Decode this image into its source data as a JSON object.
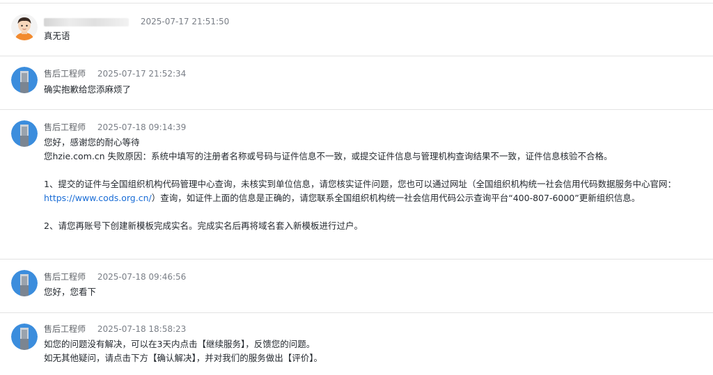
{
  "thread": {
    "messages": [
      {
        "author": "",
        "author_masked": true,
        "avatar": "user-avatar-cartoon-icon",
        "time": "2025-07-17 21:51:50",
        "lines": [
          "真无语"
        ]
      },
      {
        "author": "售后工程师",
        "avatar": "engineer-avatar-icon",
        "time": "2025-07-17 21:52:34",
        "lines": [
          "确实抱歉给您添麻烦了"
        ]
      },
      {
        "author": "售后工程师",
        "avatar": "engineer-avatar-icon",
        "time": "2025-07-18 09:14:39",
        "greeting": "您好，感谢您的耐心等待",
        "reason": "您hzie.com.cn 失败原因：系统中填写的注册者名称或号码与证件信息不一致，或提交证件信息与管理机构查询结果不一致，证件信息核验不合格。",
        "item1_prefix": "1、提交的证件与全国组织机构代码管理中心查询，未核实到单位信息，请您核实证件问题，您也可以通过网址（全国组织机构统一社会信用代码数据服务中心官网：",
        "item1_link": "https://www.cods.org.cn/",
        "item1_suffix": "）查询，如证件上面的信息是正确的，请您联系全国组织机构统一社会信用代码公示查询平台“400-807-6000”更新组织信息。",
        "item2": "2、请您再账号下创建新模板完成实名。完成实名后再将域名套入新模板进行过户。"
      },
      {
        "author": "售后工程师",
        "avatar": "engineer-avatar-icon",
        "time": "2025-07-18 09:46:56",
        "lines": [
          "您好，您看下"
        ]
      },
      {
        "author": "售后工程师",
        "avatar": "engineer-avatar-icon",
        "time": "2025-07-18 18:58:23",
        "lines": [
          "如您的问题没有解决，可以在3天内点击【继续服务】，反馈您的问题。",
          "如无其他疑问，请点击下方【确认解决】，并对我们的服务做出【评价】。"
        ]
      }
    ]
  },
  "colors": {
    "link": "#1a6dd6",
    "separator": "#e3e3e3",
    "avatar_blue": "#3b8ddd",
    "avatar_orange": "#f28a2e"
  }
}
